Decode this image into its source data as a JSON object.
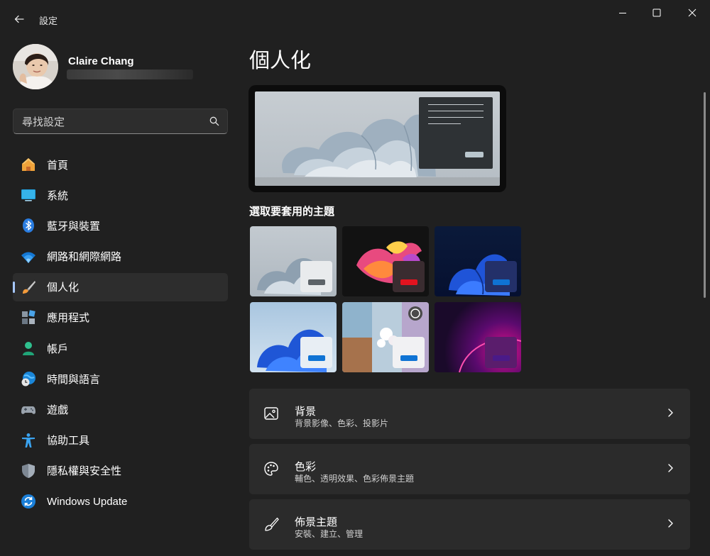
{
  "app": {
    "title": "設定"
  },
  "profile": {
    "name": "Claire Chang"
  },
  "search": {
    "placeholder": "尋找設定"
  },
  "sidebar": {
    "items": [
      {
        "label": "首頁",
        "icon": "home-icon"
      },
      {
        "label": "系統",
        "icon": "system-icon"
      },
      {
        "label": "藍牙與裝置",
        "icon": "bluetooth-icon"
      },
      {
        "label": "網路和網際網路",
        "icon": "wifi-icon"
      },
      {
        "label": "個人化",
        "icon": "brush-icon",
        "active": true
      },
      {
        "label": "應用程式",
        "icon": "apps-icon"
      },
      {
        "label": "帳戶",
        "icon": "account-icon"
      },
      {
        "label": "時間與語言",
        "icon": "time-language-icon"
      },
      {
        "label": "遊戲",
        "icon": "gamepad-icon"
      },
      {
        "label": "協助工具",
        "icon": "accessibility-icon"
      },
      {
        "label": "隱私權與安全性",
        "icon": "shield-icon"
      },
      {
        "label": "Windows Update",
        "icon": "windows-update-icon"
      }
    ]
  },
  "main": {
    "title": "個人化",
    "themes_label": "選取要套用的主題",
    "cards": [
      {
        "title": "背景",
        "subtitle": "背景影像、色彩、投影片",
        "icon": "image-icon"
      },
      {
        "title": "色彩",
        "subtitle": "輔色、透明效果、色彩佈景主題",
        "icon": "palette-icon"
      },
      {
        "title": "佈景主題",
        "subtitle": "安裝、建立、管理",
        "icon": "brush-icon"
      }
    ]
  },
  "colors": {
    "accent": "#a6c8ff",
    "background": "#202020",
    "card": "#2b2b2b"
  }
}
